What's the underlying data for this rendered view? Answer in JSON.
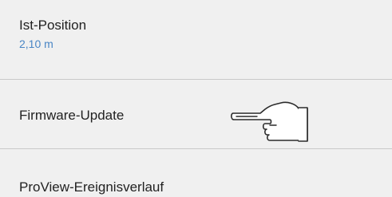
{
  "settings": {
    "items": [
      {
        "label": "Ist-Position",
        "value": "2,10 m"
      },
      {
        "label": "Firmware-Update"
      },
      {
        "label": "ProView-Ereignisverlauf"
      }
    ],
    "accent_color": "#4a86c5",
    "divider_color": "#c9c9c9",
    "background_color": "#f0f0f0"
  },
  "cursor": {
    "icon": "pointing-hand-icon"
  }
}
